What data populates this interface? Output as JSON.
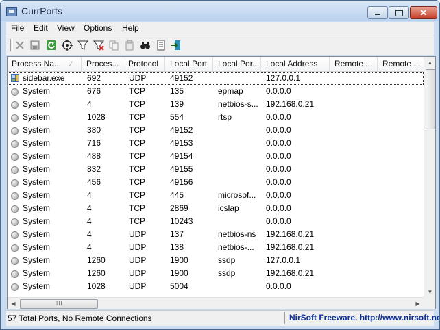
{
  "window": {
    "title": "CurrPorts"
  },
  "menu": [
    "File",
    "Edit",
    "View",
    "Options",
    "Help"
  ],
  "toolbar": {
    "buttons": [
      {
        "name": "close-connection-icon"
      },
      {
        "name": "save-icon"
      },
      {
        "name": "refresh-icon"
      },
      {
        "name": "target-icon"
      },
      {
        "name": "filter-icon"
      },
      {
        "name": "remove-filter-icon"
      },
      {
        "name": "copy-icon"
      },
      {
        "name": "properties-icon"
      },
      {
        "name": "find-icon"
      },
      {
        "name": "report-icon"
      },
      {
        "name": "exit-icon"
      }
    ]
  },
  "columns": [
    "Process Na...",
    "Proces...",
    "Protocol",
    "Local Port",
    "Local Por...",
    "Local Address",
    "Remote ...",
    "Remote ..."
  ],
  "rows": [
    {
      "process": "sidebar.exe",
      "pid": "692",
      "protocol": "UDP",
      "local_port": "49152",
      "local_port_name": "",
      "local_address": "127.0.0.1",
      "icon": "sidebar-exe-icon",
      "selected": true
    },
    {
      "process": "System",
      "pid": "676",
      "protocol": "TCP",
      "local_port": "135",
      "local_port_name": "epmap",
      "local_address": "0.0.0.0",
      "icon": "process-icon"
    },
    {
      "process": "System",
      "pid": "4",
      "protocol": "TCP",
      "local_port": "139",
      "local_port_name": "netbios-s...",
      "local_address": "192.168.0.21",
      "icon": "process-icon"
    },
    {
      "process": "System",
      "pid": "1028",
      "protocol": "TCP",
      "local_port": "554",
      "local_port_name": "rtsp",
      "local_address": "0.0.0.0",
      "icon": "process-icon"
    },
    {
      "process": "System",
      "pid": "380",
      "protocol": "TCP",
      "local_port": "49152",
      "local_port_name": "",
      "local_address": "0.0.0.0",
      "icon": "process-icon"
    },
    {
      "process": "System",
      "pid": "716",
      "protocol": "TCP",
      "local_port": "49153",
      "local_port_name": "",
      "local_address": "0.0.0.0",
      "icon": "process-icon"
    },
    {
      "process": "System",
      "pid": "488",
      "protocol": "TCP",
      "local_port": "49154",
      "local_port_name": "",
      "local_address": "0.0.0.0",
      "icon": "process-icon"
    },
    {
      "process": "System",
      "pid": "832",
      "protocol": "TCP",
      "local_port": "49155",
      "local_port_name": "",
      "local_address": "0.0.0.0",
      "icon": "process-icon"
    },
    {
      "process": "System",
      "pid": "456",
      "protocol": "TCP",
      "local_port": "49156",
      "local_port_name": "",
      "local_address": "0.0.0.0",
      "icon": "process-icon"
    },
    {
      "process": "System",
      "pid": "4",
      "protocol": "TCP",
      "local_port": "445",
      "local_port_name": "microsof...",
      "local_address": "0.0.0.0",
      "icon": "process-icon"
    },
    {
      "process": "System",
      "pid": "4",
      "protocol": "TCP",
      "local_port": "2869",
      "local_port_name": "icslap",
      "local_address": "0.0.0.0",
      "icon": "process-icon"
    },
    {
      "process": "System",
      "pid": "4",
      "protocol": "TCP",
      "local_port": "10243",
      "local_port_name": "",
      "local_address": "0.0.0.0",
      "icon": "process-icon"
    },
    {
      "process": "System",
      "pid": "4",
      "protocol": "UDP",
      "local_port": "137",
      "local_port_name": "netbios-ns",
      "local_address": "192.168.0.21",
      "icon": "process-icon"
    },
    {
      "process": "System",
      "pid": "4",
      "protocol": "UDP",
      "local_port": "138",
      "local_port_name": "netbios-...",
      "local_address": "192.168.0.21",
      "icon": "process-icon"
    },
    {
      "process": "System",
      "pid": "1260",
      "protocol": "UDP",
      "local_port": "1900",
      "local_port_name": "ssdp",
      "local_address": "127.0.0.1",
      "icon": "process-icon"
    },
    {
      "process": "System",
      "pid": "1260",
      "protocol": "UDP",
      "local_port": "1900",
      "local_port_name": "ssdp",
      "local_address": "192.168.0.21",
      "icon": "process-icon"
    },
    {
      "process": "System",
      "pid": "1028",
      "protocol": "UDP",
      "local_port": "5004",
      "local_port_name": "",
      "local_address": "0.0.0.0",
      "icon": "process-icon"
    }
  ],
  "status": {
    "summary": "57 Total Ports, No Remote Connections",
    "credit": "NirSoft Freeware.  http://www.nirsoft.net"
  }
}
